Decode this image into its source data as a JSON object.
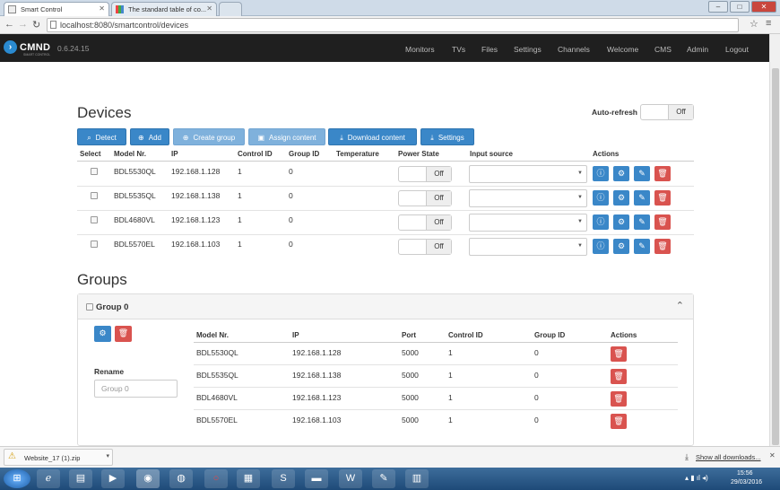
{
  "browser": {
    "tabs": [
      {
        "title": "Smart Control"
      },
      {
        "title": "The standard table of co..."
      },
      {
        "title": ""
      }
    ],
    "url": "localhost:8080/smartcontrol/devices",
    "window_buttons": [
      "–",
      "□",
      "✕"
    ]
  },
  "navbar": {
    "brand": "CMND",
    "brand_sub": "SMART CONTROL",
    "version": "0.6.24.15",
    "links": [
      "Monitors",
      "TVs",
      "Files",
      "Settings",
      "Channels",
      "Welcome",
      "CMS",
      "Admin",
      "Logout"
    ]
  },
  "devices": {
    "title": "Devices",
    "autorefresh_label": "Auto-refresh",
    "autorefresh_state": "Off",
    "toolbar": [
      "Detect",
      "Add",
      "Create group",
      "Assign content",
      "Download content",
      "Settings"
    ],
    "columns": [
      "Select",
      "Model Nr.",
      "IP",
      "Control ID",
      "Group ID",
      "Temperature",
      "Power State",
      "Input source",
      "Actions"
    ],
    "rows": [
      {
        "model": "BDL5530QL",
        "ip": "192.168.1.128",
        "control_id": "1",
        "group_id": "0",
        "temperature": "",
        "power": "Off",
        "input": ""
      },
      {
        "model": "BDL5535QL",
        "ip": "192.168.1.138",
        "control_id": "1",
        "group_id": "0",
        "temperature": "",
        "power": "Off",
        "input": ""
      },
      {
        "model": "BDL4680VL",
        "ip": "192.168.1.123",
        "control_id": "1",
        "group_id": "0",
        "temperature": "",
        "power": "Off",
        "input": ""
      },
      {
        "model": "BDL5570EL",
        "ip": "192.168.1.103",
        "control_id": "1",
        "group_id": "0",
        "temperature": "",
        "power": "Off",
        "input": ""
      }
    ]
  },
  "groups": {
    "title": "Groups",
    "group_name": "Group 0",
    "rename_label": "Rename",
    "rename_placeholder": "Group 0",
    "columns": [
      "Model Nr.",
      "IP",
      "Port",
      "Control ID",
      "Group ID",
      "Actions"
    ],
    "rows": [
      {
        "model": "BDL5530QL",
        "ip": "192.168.1.128",
        "port": "5000",
        "control_id": "1",
        "group_id": "0"
      },
      {
        "model": "BDL5535QL",
        "ip": "192.168.1.138",
        "port": "5000",
        "control_id": "1",
        "group_id": "0"
      },
      {
        "model": "BDL4680VL",
        "ip": "192.168.1.123",
        "port": "5000",
        "control_id": "1",
        "group_id": "0"
      },
      {
        "model": "BDL5570EL",
        "ip": "192.168.1.103",
        "port": "5000",
        "control_id": "1",
        "group_id": "0"
      }
    ]
  },
  "download_shelf": {
    "file": "Website_17 (1).zip",
    "show_all": "Show all downloads..."
  },
  "taskbar": {
    "time": "15:56",
    "date": "29/03/2016"
  },
  "colors": {
    "primary": "#3a87c8",
    "primary_light": "#7fb1dc",
    "danger": "#d9534f",
    "navbar": "#1f1f1f"
  }
}
